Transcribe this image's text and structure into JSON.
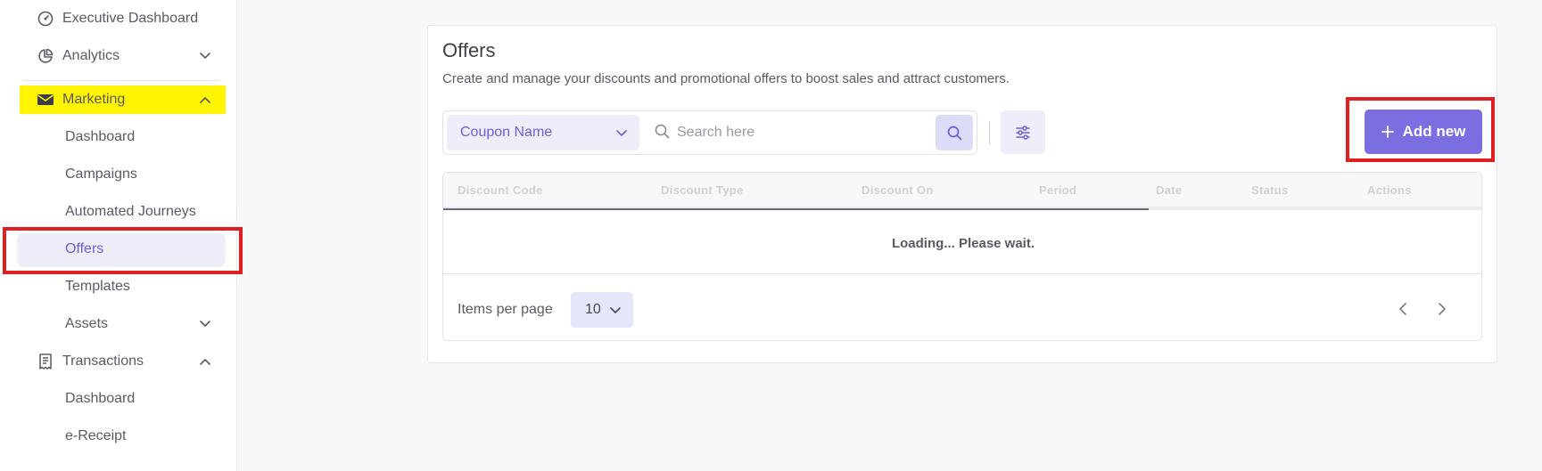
{
  "sidebar": {
    "items": [
      {
        "label": "Executive Dashboard",
        "icon": "dashboard-gauge-icon"
      },
      {
        "label": "Analytics",
        "icon": "pie-chart-icon"
      },
      {
        "label": "Marketing",
        "icon": "envelope-icon"
      },
      {
        "label": "Dashboard"
      },
      {
        "label": "Campaigns"
      },
      {
        "label": "Automated Journeys"
      },
      {
        "label": "Offers"
      },
      {
        "label": "Templates"
      },
      {
        "label": "Assets"
      },
      {
        "label": "Transactions",
        "icon": "receipt-icon"
      },
      {
        "label": "Dashboard"
      },
      {
        "label": "e-Receipt"
      }
    ]
  },
  "main": {
    "title": "Offers",
    "description": "Create and manage your discounts and promotional offers to boost sales and attract customers.",
    "filter_select": "Coupon Name",
    "search_placeholder": "Search here",
    "add_button": "Add new",
    "table": {
      "columns": [
        "Discount Code",
        "Discount Type",
        "Discount On",
        "Period",
        "Date",
        "Status",
        "Actions"
      ],
      "loading_text": "Loading... Please wait."
    },
    "pagination": {
      "items_per_page_label": "Items per page",
      "items_per_page_value": "10"
    }
  },
  "colors": {
    "accent": "#7a6ee0",
    "highlight_yellow": "#fff500",
    "annotation_red": "#e02020"
  }
}
